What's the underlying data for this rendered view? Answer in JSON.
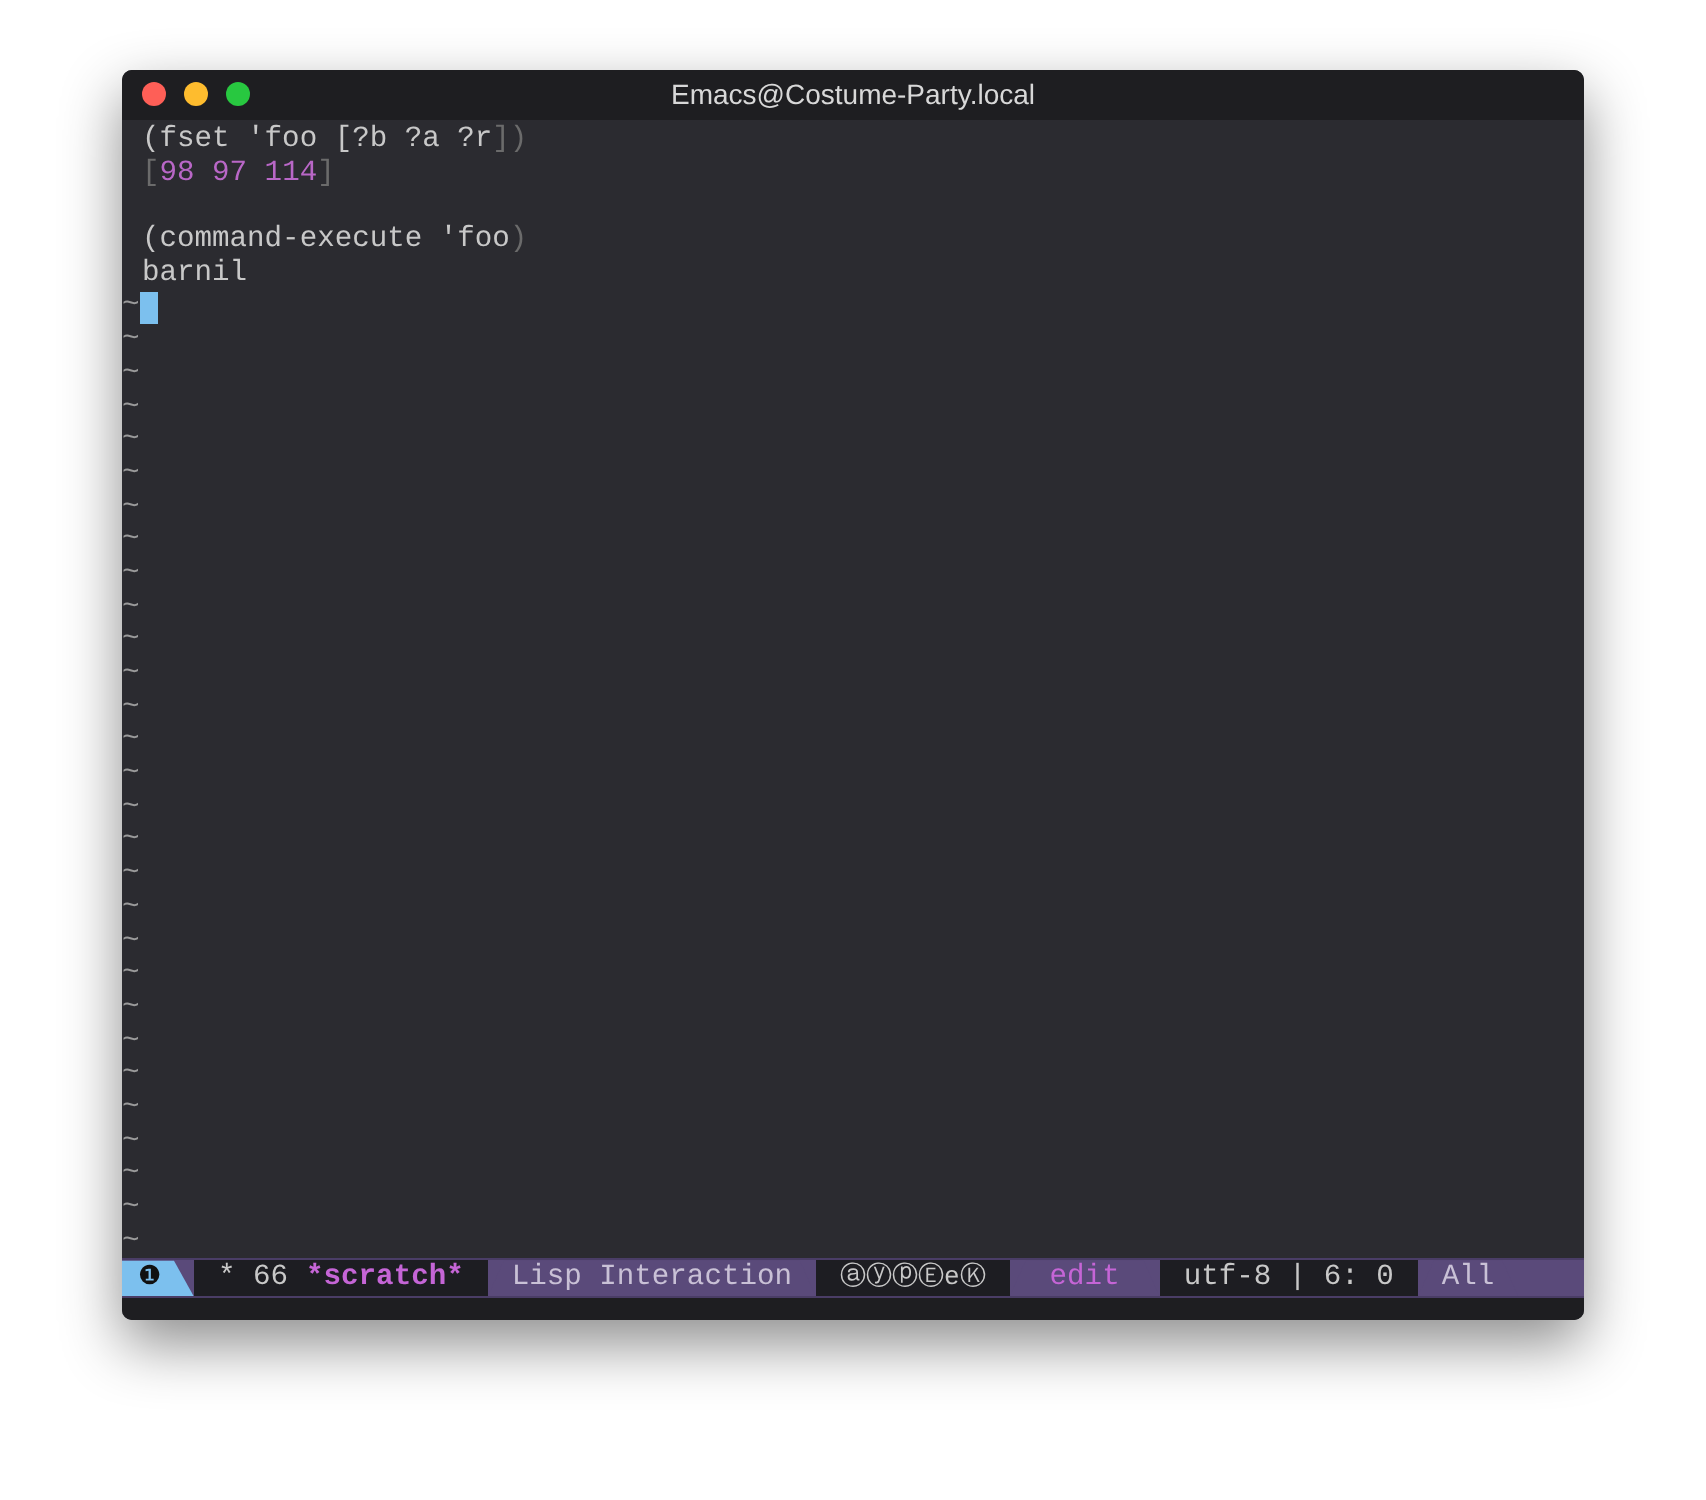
{
  "window": {
    "title": "Emacs@Costume-Party.local"
  },
  "buffer_lines": [
    [
      {
        "kind": "code",
        "text": "(fset 'foo [?b ?a ?r"
      },
      {
        "kind": "paren",
        "text": "])"
      }
    ],
    [
      {
        "kind": "paren",
        "text": "["
      },
      {
        "kind": "number",
        "text": "98 97 114"
      },
      {
        "kind": "paren",
        "text": "]"
      }
    ],
    {
      "kind": "blank"
    },
    [
      {
        "kind": "code",
        "text": "(command-execute 'foo"
      },
      {
        "kind": "paren",
        "text": ")"
      }
    ],
    [
      {
        "kind": "code",
        "text": "barnil"
      }
    ]
  ],
  "fringe_tildes": [
    "~",
    "~",
    "~",
    "~",
    "~",
    "~",
    "~",
    "~",
    "~",
    "~",
    "~",
    "~",
    "~",
    "~",
    "~",
    "~",
    "~",
    "~",
    "~",
    "~",
    "~",
    "~",
    "~",
    "~",
    "~",
    "~",
    "~",
    "~",
    "~"
  ],
  "mode_line": [
    {
      "kind": "window_number",
      "text": "❶"
    },
    {
      "kind": "buffer",
      "parts": [
        {
          "kind": "plain",
          "text": "* 66"
        },
        {
          "kind": "name",
          "text": "*scratch*"
        }
      ]
    },
    {
      "kind": "mode",
      "text": "Lisp Interaction"
    },
    {
      "kind": "minor",
      "text": "ⓐⓨⓟⒺeⓀ"
    },
    {
      "kind": "state",
      "text": "edit"
    },
    {
      "kind": "position",
      "text": "utf-8 | 6: 0"
    },
    {
      "kind": "mode",
      "text": "All"
    }
  ]
}
